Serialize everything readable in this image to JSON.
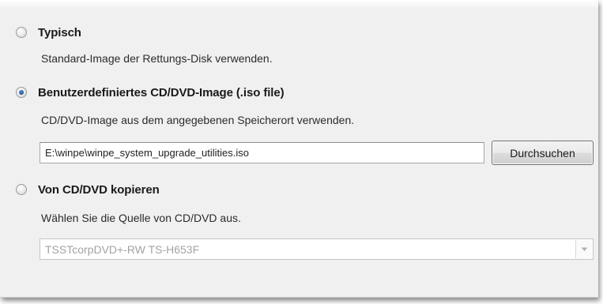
{
  "options": {
    "typical": {
      "label": "Typisch",
      "description": "Standard-Image der Rettungs-Disk verwenden.",
      "checked": false
    },
    "custom_image": {
      "label": "Benutzerdefiniertes CD/DVD-Image (.iso file)",
      "description": "CD/DVD-Image aus dem angegebenen Speicherort verwenden.",
      "checked": true,
      "path_value": "E:\\winpe\\winpe_system_upgrade_utilities.iso",
      "browse_label": "Durchsuchen"
    },
    "copy_from_disc": {
      "label": "Von CD/DVD kopieren",
      "description": "Wählen Sie die Quelle von CD/DVD aus.",
      "checked": false,
      "selected_drive": "TSSTcorpDVD+-RW TS-H653F",
      "disabled": true
    }
  },
  "colors": {
    "panel_background": "#f0f0f0",
    "radio_dot": "#1f4f9a",
    "disabled_text": "#a3a3a3"
  },
  "icons": {
    "dropdown": "chevron-down-icon"
  }
}
